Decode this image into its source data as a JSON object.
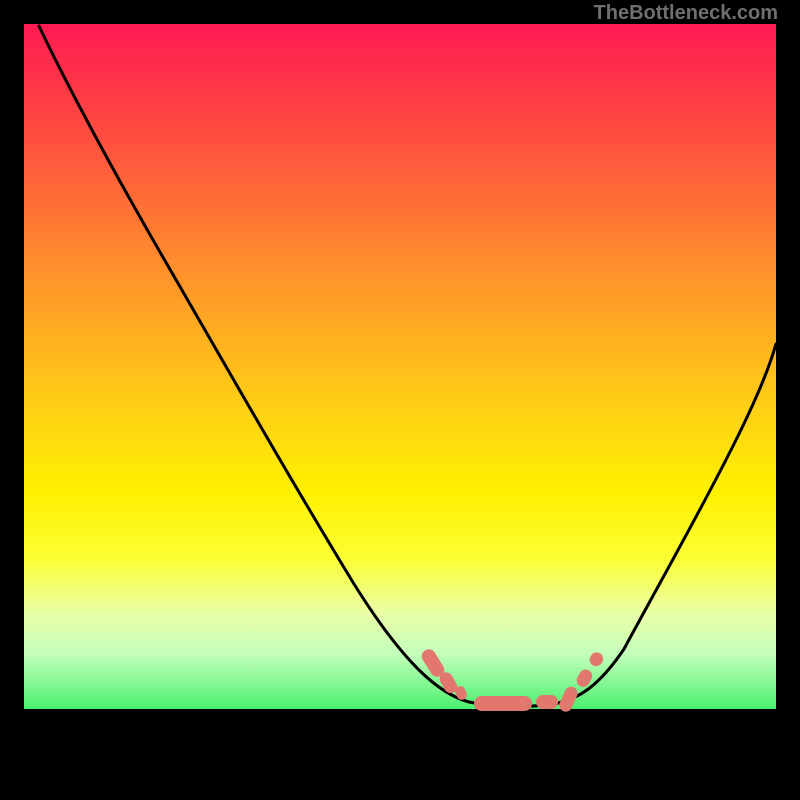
{
  "watermark": "TheBottleneck.com",
  "chart_data": {
    "type": "line",
    "title": "",
    "xlabel": "",
    "ylabel": "",
    "xlim": [
      0,
      100
    ],
    "ylim": [
      0,
      100
    ],
    "grid": false,
    "legend": false,
    "series": [
      {
        "name": "bottleneck-curve",
        "x": [
          0,
          5,
          10,
          15,
          20,
          25,
          30,
          35,
          40,
          45,
          50,
          55,
          58,
          62,
          66,
          70,
          74,
          78,
          82,
          86,
          90,
          94,
          98,
          100
        ],
        "y": [
          100,
          93,
          86,
          79,
          72,
          64,
          56,
          48,
          39,
          30,
          21,
          12,
          7,
          3,
          1,
          1,
          1,
          3,
          7,
          14,
          22,
          31,
          40,
          46
        ]
      }
    ],
    "markers": {
      "note": "salmon dashed/rounded marker cluster near curve minimum",
      "x_range": [
        55,
        77
      ],
      "y_approx": 1
    },
    "background": {
      "type": "vertical-gradient",
      "stops": [
        {
          "pct": 0,
          "color": "#ff1a53"
        },
        {
          "pct": 20,
          "color": "#ff5a3c"
        },
        {
          "pct": 46,
          "color": "#ffb11f"
        },
        {
          "pct": 68,
          "color": "#fff000"
        },
        {
          "pct": 86,
          "color": "#e9ffa8"
        },
        {
          "pct": 100,
          "color": "#4bf06f"
        }
      ]
    }
  }
}
